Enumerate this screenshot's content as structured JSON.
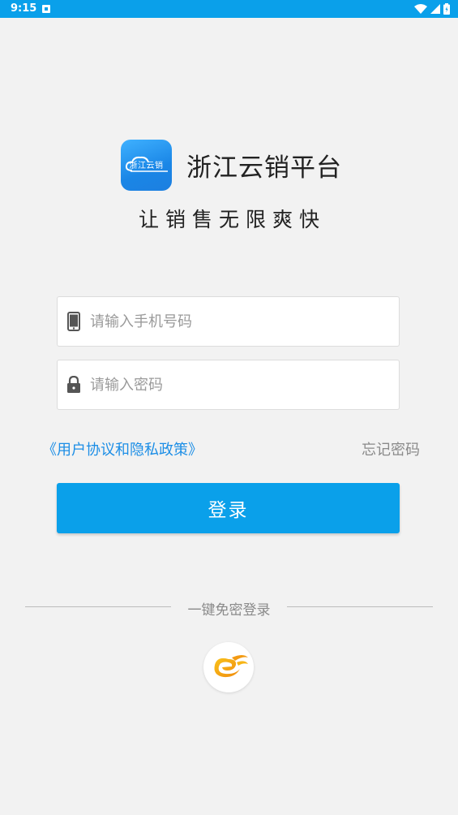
{
  "status_bar": {
    "time": "9:15",
    "background": "#0aa0ea"
  },
  "brand": {
    "logo_text": "浙江云销",
    "app_name": "浙江云销平台",
    "slogan": "让销售无限爽快"
  },
  "form": {
    "phone_placeholder": "请输入手机号码",
    "phone_value": "",
    "password_placeholder": "请输入密码",
    "password_value": "",
    "phone_icon": "phone-icon",
    "lock_icon": "lock-icon"
  },
  "links": {
    "agreement": "《用户协议和隐私政策》",
    "forgot_password": "忘记密码"
  },
  "login_button": {
    "label": "登录",
    "color": "#0aa0ea"
  },
  "divider": {
    "text": "一键免密登录"
  },
  "oneclick": {
    "icon": "telecom-logo-icon"
  },
  "colors": {
    "accent": "#0aa0ea",
    "link": "#1c8ee6",
    "background": "#f2f2f2"
  }
}
